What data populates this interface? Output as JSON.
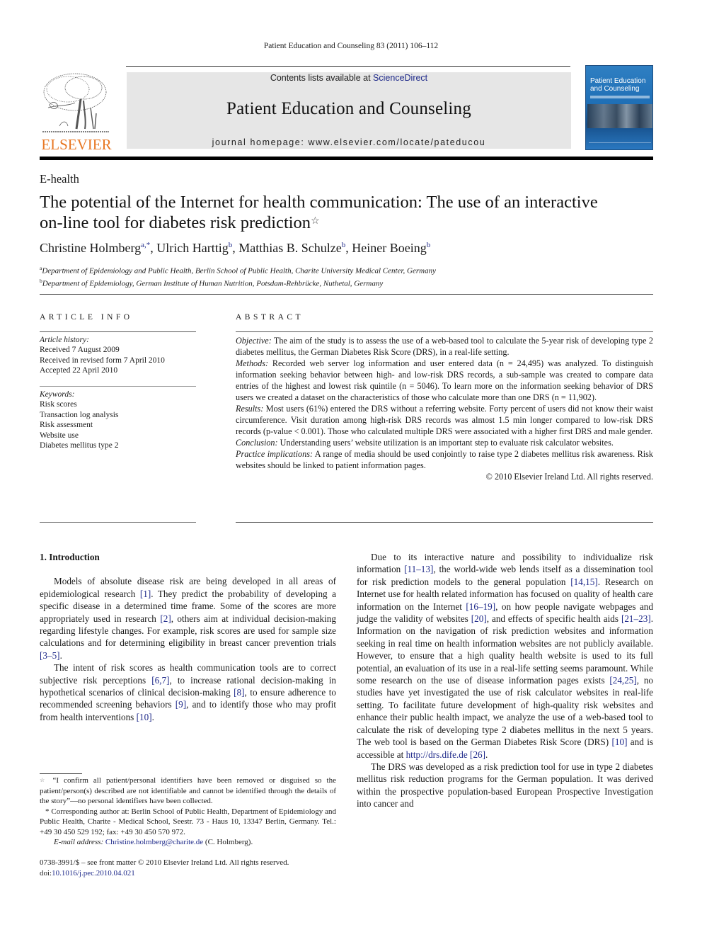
{
  "running_head": "Patient Education and Counseling 83 (2011) 106–112",
  "publisher": {
    "logo_icon": "elsevier-tree-icon",
    "name": "ELSEVIER",
    "brand_color": "#e87722"
  },
  "masthead": {
    "contents_prefix": "Contents lists available at ",
    "contents_link": "ScienceDirect",
    "journal_title": "Patient Education and Counseling",
    "homepage": "journal homepage: www.elsevier.com/locate/pateducou",
    "background_color": "#e6e6e6"
  },
  "cover": {
    "title_line1": "Patient Education",
    "title_line2": "and Counseling",
    "color": "#1f6fb6"
  },
  "article": {
    "section": "E-health",
    "title_line1": "The potential of the Internet for health communication: The use of an interactive",
    "title_line2": "on-line tool for diabetes risk prediction",
    "title_note_marker": "☆",
    "authors": [
      {
        "name": "Christine Holmberg",
        "sup": "a,*"
      },
      {
        "name": "Ulrich Harttig",
        "sup": "b"
      },
      {
        "name": "Matthias B. Schulze",
        "sup": "b"
      },
      {
        "name": "Heiner Boeing",
        "sup": "b"
      }
    ],
    "affiliations": [
      {
        "sup": "a",
        "text": "Department of Epidemiology and Public Health, Berlin School of Public Health, Charite University Medical Center, Germany"
      },
      {
        "sup": "b",
        "text": "Department of Epidemiology, German Institute of Human Nutrition, Potsdam-Rehbrücke, Nuthetal, Germany"
      }
    ]
  },
  "article_info": {
    "heading": "ARTICLE INFO",
    "history_label": "Article history:",
    "history": [
      "Received 7 August 2009",
      "Received in revised form 7 April 2010",
      "Accepted 22 April 2010"
    ],
    "keywords_label": "Keywords:",
    "keywords": [
      "Risk scores",
      "Transaction log analysis",
      "Risk assessment",
      "Website use",
      "Diabetes mellitus type 2"
    ]
  },
  "abstract": {
    "heading": "ABSTRACT",
    "objective_label": "Objective:",
    "objective": " The aim of the study is to assess the use of a web-based tool to calculate the 5-year risk of developing type 2 diabetes mellitus, the German Diabetes Risk Score (DRS), in a real-life setting.",
    "methods_label": "Methods:",
    "methods": " Recorded web server log information and user entered data (n = 24,495) was analyzed. To distinguish information seeking behavior between high- and low-risk DRS records, a sub-sample was created to compare data entries of the highest and lowest risk quintile (n = 5046). To learn more on the information seeking behavior of DRS users we created a dataset on the characteristics of those who calculate more than one DRS (n = 11,902).",
    "results_label": "Results:",
    "results": " Most users (61%) entered the DRS without a referring website. Forty percent of users did not know their waist circumference. Visit duration among high-risk DRS records was almost 1.5 min longer compared to low-risk DRS records (p-value < 0.001). Those who calculated multiple DRS were associated with a higher first DRS and male gender.",
    "conclusion_label": "Conclusion:",
    "conclusion": " Understanding users’ website utilization is an important step to evaluate risk calculator websites.",
    "practice_label": "Practice implications:",
    "practice": " A range of media should be used conjointly to raise type 2 diabetes mellitus risk awareness. Risk websites should be linked to patient information pages.",
    "copyright": "© 2010 Elsevier Ireland Ltd. All rights reserved."
  },
  "body": {
    "section_heading": "1.  Introduction",
    "left_p1": [
      {
        "t": "Models of absolute disease risk are being developed in all areas of epidemiological research "
      },
      {
        "ref": "[1]"
      },
      {
        "t": ". They predict the probability of developing a specific disease in a determined time frame. Some of the scores are more appropriately used in research "
      },
      {
        "ref": "[2]"
      },
      {
        "t": ", others aim at individual decision-making regarding lifestyle changes. For example, risk scores are used for sample size calculations and for determining eligibility in breast cancer prevention trials "
      },
      {
        "ref": "[3–5]"
      },
      {
        "t": "."
      }
    ],
    "left_p2": [
      {
        "t": "The intent of risk scores as health communication tools are to correct subjective risk perceptions "
      },
      {
        "ref": "[6,7]"
      },
      {
        "t": ", to increase rational decision-making in hypothetical scenarios of clinical decision-making "
      },
      {
        "ref": "[8]"
      },
      {
        "t": ", to ensure adherence to recommended screening behaviors "
      },
      {
        "ref": "[9]"
      },
      {
        "t": ", and to identify those who may profit from health interventions "
      },
      {
        "ref": "[10]"
      },
      {
        "t": "."
      }
    ],
    "right_p1": [
      {
        "t": "Due to its interactive nature and possibility to individualize risk information "
      },
      {
        "ref": "[11–13]"
      },
      {
        "t": ", the world-wide web lends itself as a dissemination tool for risk prediction models to the general population "
      },
      {
        "ref": "[14,15]"
      },
      {
        "t": ". Research on Internet use for health related information has focused on quality of health care information on the Internet "
      },
      {
        "ref": "[16–19]"
      },
      {
        "t": ", on how people navigate webpages and judge the validity of websites "
      },
      {
        "ref": "[20]"
      },
      {
        "t": ", and effects of specific health aids "
      },
      {
        "ref": "[21–23]"
      },
      {
        "t": ". Information on the navigation of risk prediction websites and information seeking in real time on health information websites are not publicly available. However, to ensure that a high quality health website is used to its full potential, an evaluation of its use in a real-life setting seems paramount. While some research on the use of disease information pages exists "
      },
      {
        "ref": "[24,25]"
      },
      {
        "t": ", no studies have yet investigated the use of risk calculator websites in real-life setting. To facilitate future development of high-quality risk websites and enhance their public health impact, we analyze the use of a web-based tool to calculate the risk of developing type 2 diabetes mellitus in the next 5 years. The web tool is based on the German Diabetes Risk Score (DRS) "
      },
      {
        "ref": "[10]"
      },
      {
        "t": " and is accessible at "
      },
      {
        "ref": "http://drs.dife.de"
      },
      {
        "t": " "
      },
      {
        "ref": "[26]"
      },
      {
        "t": "."
      }
    ],
    "right_p2": [
      {
        "t": "The DRS was developed as a risk prediction tool for use in type 2 diabetes mellitus risk reduction programs for the German population. It was derived within the prospective population-based European Prospective Investigation into cancer and"
      }
    ]
  },
  "footnotes": {
    "star_marker": "☆",
    "star_note": " “I confirm all patient/personal identifiers have been removed or disguised so the patient/person(s) described are not identifiable and cannot be identified through the details of the story”—no personal identifiers have been collected.",
    "corresponding": "* Corresponding author at: Berlin School of Public Health, Department of Epidemiology and Public Health, Charite - Medical School, Seestr. 73 - Haus 10, 13347 Berlin, Germany. Tel.: +49 30 450 529 192; fax: +49 30 450 570 972.",
    "email_label": "E-mail address:",
    "email": "Christine.holmberg@charite.de",
    "email_suffix": " (C. Holmberg)."
  },
  "front_matter": {
    "issn_line": "0738-3991/$ – see front matter © 2010 Elsevier Ireland Ltd. All rights reserved.",
    "doi_prefix": "doi:",
    "doi": "10.1016/j.pec.2010.04.021"
  }
}
